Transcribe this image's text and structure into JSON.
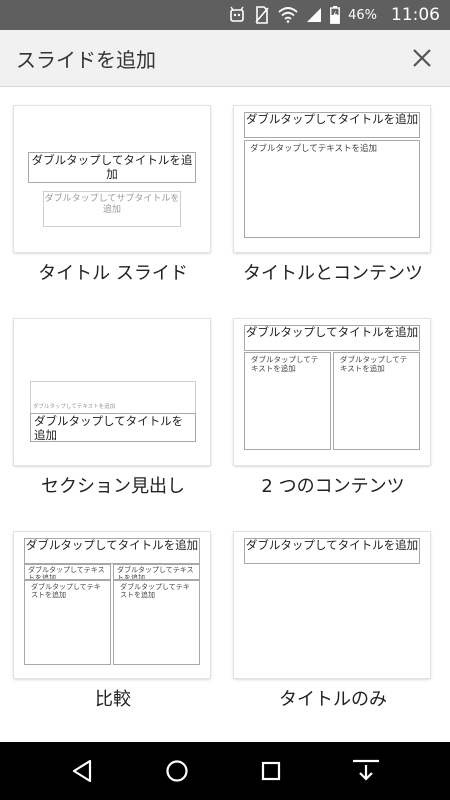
{
  "status": {
    "battery_percent": "46%",
    "time": "11:06",
    "icons": [
      "android-debug-icon",
      "no-sim-icon",
      "wifi-icon",
      "signal-icon",
      "battery-charging-icon"
    ]
  },
  "header": {
    "title": "スライドを追加",
    "close_icon": "close-icon"
  },
  "placeholders": {
    "title": "ダブルタップしてタイトルを追加",
    "subtitle": "ダブルタップしてサブタイトルを追加",
    "text": "ダブルタップしてテキストを追加"
  },
  "layouts": [
    {
      "label": "タイトル スライド"
    },
    {
      "label": "タイトルとコンテンツ"
    },
    {
      "label": "セクション見出し"
    },
    {
      "label": "2 つのコンテンツ"
    },
    {
      "label": "比較"
    },
    {
      "label": "タイトルのみ"
    }
  ],
  "navigation": [
    "back-icon",
    "home-icon",
    "recents-icon",
    "keyboard-hide-icon"
  ],
  "colors": {
    "status_bar": "#5f5f5f",
    "app_bar": "#f1f1f1",
    "nav_bar": "#000000"
  }
}
